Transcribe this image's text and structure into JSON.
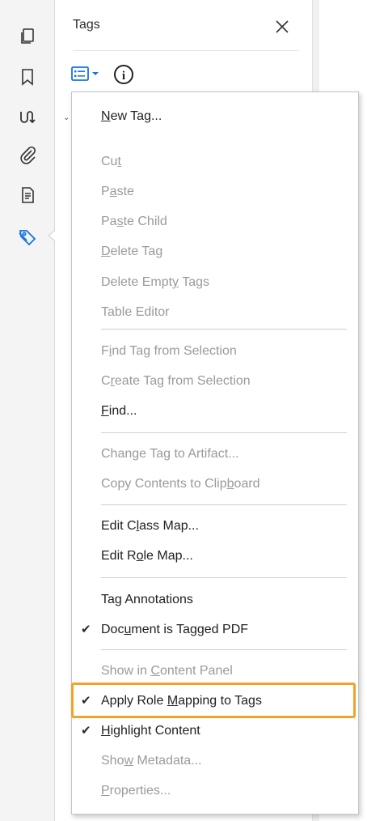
{
  "rail": {
    "icons": [
      {
        "name": "pages-icon"
      },
      {
        "name": "bookmark-icon"
      },
      {
        "name": "signature-icon"
      },
      {
        "name": "attachment-icon"
      },
      {
        "name": "document-properties-icon"
      },
      {
        "name": "tags-icon",
        "active": true
      }
    ]
  },
  "panel": {
    "title": "Tags",
    "close_icon": "close-icon",
    "options_icon": "options-menu-icon",
    "info_icon": "info-icon",
    "info_glyph": "i"
  },
  "menu": {
    "items": [
      {
        "pre": "",
        "u": "N",
        "post": "ew Tag...",
        "enabled": true,
        "checked": false
      },
      {
        "pre": "Cu",
        "u": "t",
        "post": "",
        "enabled": false,
        "checked": false
      },
      {
        "pre": "P",
        "u": "a",
        "post": "ste",
        "enabled": false,
        "checked": false
      },
      {
        "pre": "Pa",
        "u": "s",
        "post": "te Child",
        "enabled": false,
        "checked": false
      },
      {
        "pre": "",
        "u": "D",
        "post": "elete Tag",
        "enabled": false,
        "checked": false
      },
      {
        "pre": "Delete Empt",
        "u": "y",
        "post": " Tags",
        "enabled": false,
        "checked": false
      },
      {
        "pre": "Table Editor",
        "u": "",
        "post": "",
        "enabled": false,
        "checked": false
      },
      {
        "pre": "F",
        "u": "i",
        "post": "nd Tag from Selection",
        "enabled": false,
        "checked": false
      },
      {
        "pre": "C",
        "u": "r",
        "post": "eate Tag from Selection",
        "enabled": false,
        "checked": false
      },
      {
        "pre": "",
        "u": "F",
        "post": "ind...",
        "enabled": true,
        "checked": false
      },
      {
        "pre": "Chan",
        "u": "g",
        "post": "e Tag to Artifact...",
        "enabled": false,
        "checked": false
      },
      {
        "pre": "Copy Contents to Clip",
        "u": "b",
        "post": "oard",
        "enabled": false,
        "checked": false
      },
      {
        "pre": "Edit C",
        "u": "l",
        "post": "ass Map...",
        "enabled": true,
        "checked": false
      },
      {
        "pre": "Edit R",
        "u": "o",
        "post": "le Map...",
        "enabled": true,
        "checked": false
      },
      {
        "pre": "Ta",
        "u": "g",
        "post": " Annotations",
        "enabled": true,
        "checked": false
      },
      {
        "pre": "Doc",
        "u": "u",
        "post": "ment is Tagged PDF",
        "enabled": true,
        "checked": true
      },
      {
        "pre": "Show in ",
        "u": "C",
        "post": "ontent Panel",
        "enabled": false,
        "checked": false
      },
      {
        "pre": "Apply Role ",
        "u": "M",
        "post": "apping to Tags",
        "enabled": true,
        "checked": true
      },
      {
        "pre": "",
        "u": "H",
        "post": "ighlight Content",
        "enabled": true,
        "checked": true
      },
      {
        "pre": "Sho",
        "u": "w",
        "post": " Metadata...",
        "enabled": false,
        "checked": false
      },
      {
        "pre": "",
        "u": "P",
        "post": "roperties...",
        "enabled": false,
        "checked": false
      }
    ],
    "check_glyph": "✔"
  },
  "colors": {
    "accent_blue": "#1473e6",
    "highlight_orange": "#f0a32a",
    "disabled_text": "#9a9a9a"
  }
}
